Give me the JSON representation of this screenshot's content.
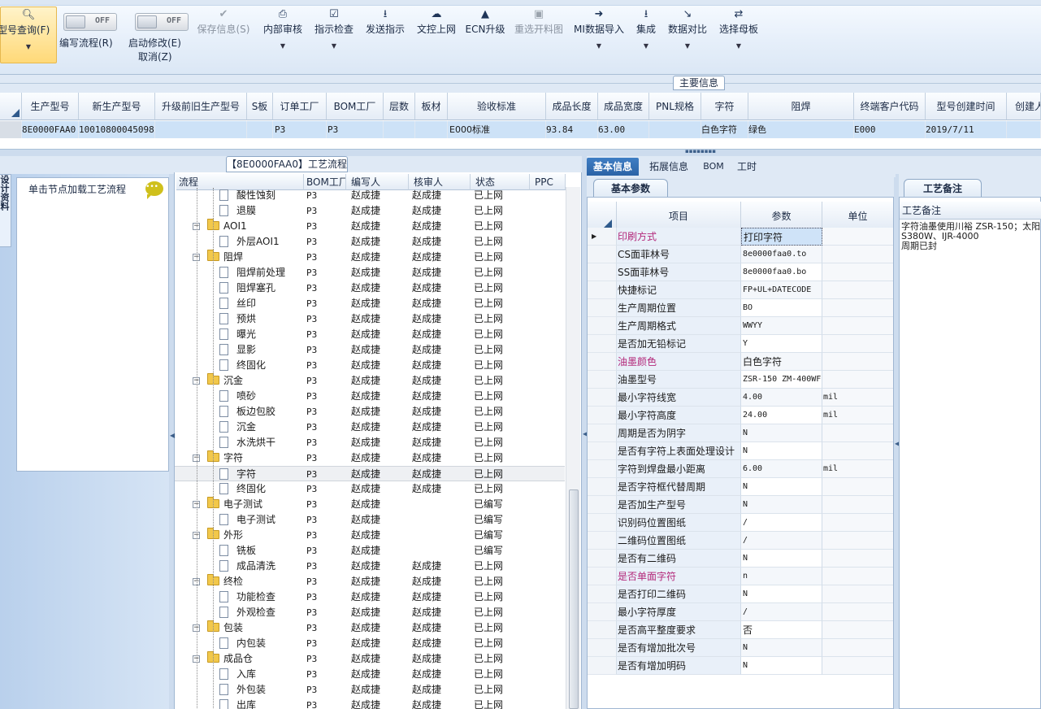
{
  "toolbar": {
    "model_query": "型号查询(F)",
    "write_flow_toggle": "OFF",
    "write_flow": "编写流程(R)",
    "start_modify_toggle": "OFF",
    "start_modify": "启动修改(E)",
    "cancel": "取消(Z)",
    "save_info": "保存信息(S)",
    "internal_review": "内部审核",
    "instruction_check": "指示检查",
    "send_instruction": "发送指示",
    "upload_doc": "文控上网",
    "ecn_upgrade": "ECN升级",
    "reselect_cut_drawing": "重选开料图",
    "mi_import": "MI数据导入",
    "integrate": "集成",
    "data_compare": "数据对比",
    "select_master": "选择母板"
  },
  "main_info_tab": "主要信息",
  "top_grid": {
    "columns": [
      "生产型号",
      "新生产型号",
      "升级前旧生产型号",
      "S板",
      "订单工厂",
      "BOM工厂",
      "层数",
      "板材",
      "验收标准",
      "成品长度",
      "成品宽度",
      "PNL规格",
      "字符",
      "阻焊",
      "终端客户代码",
      "型号创建时间",
      "创建人"
    ],
    "row": [
      "8E0000FAA0",
      "10010800045098",
      "",
      "",
      "P3",
      "P3",
      "",
      "",
      "E000标准",
      "93.84",
      "63.00",
      "",
      "白色字符",
      "绿色",
      "E000",
      "2019/7/11",
      ""
    ]
  },
  "left_panel": {
    "vtab": "设计资料",
    "message": "单击节点加载工艺流程"
  },
  "process": {
    "title": "【8E0000FAA0】工艺流程",
    "columns": [
      "流程",
      "BOM工厂",
      "编写人",
      "核审人",
      "状态",
      "PPC"
    ],
    "rows": [
      {
        "name": "酸性蚀刻",
        "level": 1,
        "bom": "P3",
        "writer": "赵成捷",
        "reviewer": "赵成捷",
        "status": "已上网"
      },
      {
        "name": "退膜",
        "level": 1,
        "bom": "P3",
        "writer": "赵成捷",
        "reviewer": "赵成捷",
        "status": "已上网"
      },
      {
        "name": "AOI1",
        "level": 0,
        "bom": "P3",
        "writer": "赵成捷",
        "reviewer": "赵成捷",
        "status": "已上网"
      },
      {
        "name": "外层AOI1",
        "level": 1,
        "bom": "P3",
        "writer": "赵成捷",
        "reviewer": "赵成捷",
        "status": "已上网"
      },
      {
        "name": "阻焊",
        "level": 0,
        "bom": "P3",
        "writer": "赵成捷",
        "reviewer": "赵成捷",
        "status": "已上网"
      },
      {
        "name": "阻焊前处理",
        "level": 1,
        "bom": "P3",
        "writer": "赵成捷",
        "reviewer": "赵成捷",
        "status": "已上网"
      },
      {
        "name": "阻焊塞孔",
        "level": 1,
        "bom": "P3",
        "writer": "赵成捷",
        "reviewer": "赵成捷",
        "status": "已上网"
      },
      {
        "name": "丝印",
        "level": 1,
        "bom": "P3",
        "writer": "赵成捷",
        "reviewer": "赵成捷",
        "status": "已上网"
      },
      {
        "name": "预烘",
        "level": 1,
        "bom": "P3",
        "writer": "赵成捷",
        "reviewer": "赵成捷",
        "status": "已上网"
      },
      {
        "name": "曝光",
        "level": 1,
        "bom": "P3",
        "writer": "赵成捷",
        "reviewer": "赵成捷",
        "status": "已上网"
      },
      {
        "name": "显影",
        "level": 1,
        "bom": "P3",
        "writer": "赵成捷",
        "reviewer": "赵成捷",
        "status": "已上网"
      },
      {
        "name": "终固化",
        "level": 1,
        "bom": "P3",
        "writer": "赵成捷",
        "reviewer": "赵成捷",
        "status": "已上网"
      },
      {
        "name": "沉金",
        "level": 0,
        "bom": "P3",
        "writer": "赵成捷",
        "reviewer": "赵成捷",
        "status": "已上网"
      },
      {
        "name": "喷砂",
        "level": 1,
        "bom": "P3",
        "writer": "赵成捷",
        "reviewer": "赵成捷",
        "status": "已上网"
      },
      {
        "name": "板边包胶",
        "level": 1,
        "bom": "P3",
        "writer": "赵成捷",
        "reviewer": "赵成捷",
        "status": "已上网"
      },
      {
        "name": "沉金",
        "level": 1,
        "bom": "P3",
        "writer": "赵成捷",
        "reviewer": "赵成捷",
        "status": "已上网"
      },
      {
        "name": "水洗烘干",
        "level": 1,
        "bom": "P3",
        "writer": "赵成捷",
        "reviewer": "赵成捷",
        "status": "已上网"
      },
      {
        "name": "字符",
        "level": 0,
        "bom": "P3",
        "writer": "赵成捷",
        "reviewer": "赵成捷",
        "status": "已上网"
      },
      {
        "name": "字符",
        "level": 1,
        "bom": "P3",
        "writer": "赵成捷",
        "reviewer": "赵成捷",
        "status": "已上网"
      },
      {
        "name": "终固化",
        "level": 1,
        "bom": "P3",
        "writer": "赵成捷",
        "reviewer": "赵成捷",
        "status": "已上网"
      },
      {
        "name": "电子测试",
        "level": 0,
        "bom": "P3",
        "writer": "赵成捷",
        "reviewer": "",
        "status": "已编写"
      },
      {
        "name": "电子测试",
        "level": 1,
        "bom": "P3",
        "writer": "赵成捷",
        "reviewer": "",
        "status": "已编写"
      },
      {
        "name": "外形",
        "level": 0,
        "bom": "P3",
        "writer": "赵成捷",
        "reviewer": "",
        "status": "已编写"
      },
      {
        "name": "铣板",
        "level": 1,
        "bom": "P3",
        "writer": "赵成捷",
        "reviewer": "",
        "status": "已编写"
      },
      {
        "name": "成品清洗",
        "level": 1,
        "bom": "P3",
        "writer": "赵成捷",
        "reviewer": "赵成捷",
        "status": "已上网"
      },
      {
        "name": "终检",
        "level": 0,
        "bom": "P3",
        "writer": "赵成捷",
        "reviewer": "赵成捷",
        "status": "已上网"
      },
      {
        "name": "功能检查",
        "level": 1,
        "bom": "P3",
        "writer": "赵成捷",
        "reviewer": "赵成捷",
        "status": "已上网"
      },
      {
        "name": "外观检查",
        "level": 1,
        "bom": "P3",
        "writer": "赵成捷",
        "reviewer": "赵成捷",
        "status": "已上网"
      },
      {
        "name": "包装",
        "level": 0,
        "bom": "P3",
        "writer": "赵成捷",
        "reviewer": "赵成捷",
        "status": "已上网"
      },
      {
        "name": "内包装",
        "level": 1,
        "bom": "P3",
        "writer": "赵成捷",
        "reviewer": "赵成捷",
        "status": "已上网"
      },
      {
        "name": "成品仓",
        "level": 0,
        "bom": "P3",
        "writer": "赵成捷",
        "reviewer": "赵成捷",
        "status": "已上网"
      },
      {
        "name": "入库",
        "level": 1,
        "bom": "P3",
        "writer": "赵成捷",
        "reviewer": "赵成捷",
        "status": "已上网"
      },
      {
        "name": "外包装",
        "level": 1,
        "bom": "P3",
        "writer": "赵成捷",
        "reviewer": "赵成捷",
        "status": "已上网"
      },
      {
        "name": "出库",
        "level": 1,
        "bom": "P3",
        "writer": "赵成捷",
        "reviewer": "赵成捷",
        "status": "已上网"
      }
    ]
  },
  "detail_tabs": [
    "基本信息",
    "拓展信息",
    "BOM",
    "工时"
  ],
  "basic_param_tab": "基本参数",
  "params": {
    "columns": [
      "项目",
      "参数",
      "单位"
    ],
    "rows": [
      {
        "name": "印刷方式",
        "value": "打印字符",
        "unit": "",
        "hl": true,
        "cjk": true
      },
      {
        "name": "CS面菲林号",
        "value": "8e0000faa0.to",
        "unit": ""
      },
      {
        "name": "SS面菲林号",
        "value": "8e0000faa0.bo",
        "unit": ""
      },
      {
        "name": "快捷标记",
        "value": "FP+UL+DATECODE",
        "unit": ""
      },
      {
        "name": "生产周期位置",
        "value": "BO",
        "unit": ""
      },
      {
        "name": "生产周期格式",
        "value": "WWYY",
        "unit": ""
      },
      {
        "name": "是否加无铅标记",
        "value": "Y",
        "unit": ""
      },
      {
        "name": "油墨颜色",
        "value": "白色字符",
        "unit": "",
        "hl": true,
        "cjk": true
      },
      {
        "name": "油墨型号",
        "value": "ZSR-150 ZM-400WF",
        "unit": ""
      },
      {
        "name": "最小字符线宽",
        "value": "4.00",
        "unit": "mil"
      },
      {
        "name": "最小字符高度",
        "value": "24.00",
        "unit": "mil"
      },
      {
        "name": "周期是否为阴字",
        "value": "N",
        "unit": ""
      },
      {
        "name": "是否有字符上表面处理设计",
        "value": "N",
        "unit": ""
      },
      {
        "name": "字符到焊盘最小距离",
        "value": "6.00",
        "unit": "mil"
      },
      {
        "name": "是否字符框代替周期",
        "value": "N",
        "unit": ""
      },
      {
        "name": "是否加生产型号",
        "value": "N",
        "unit": ""
      },
      {
        "name": "识别码位置图纸",
        "value": "/",
        "unit": ""
      },
      {
        "name": "二维码位置图纸",
        "value": "/",
        "unit": ""
      },
      {
        "name": "是否有二维码",
        "value": "N",
        "unit": ""
      },
      {
        "name": "是否单面字符",
        "value": "n",
        "unit": "",
        "hl": true
      },
      {
        "name": "是否打印二维码",
        "value": "N",
        "unit": ""
      },
      {
        "name": "最小字符厚度",
        "value": "/",
        "unit": ""
      },
      {
        "name": "是否高平整度要求",
        "value": "否",
        "unit": "",
        "cjk": true
      },
      {
        "name": "是否有增加批次号",
        "value": "N",
        "unit": ""
      },
      {
        "name": "是否有增加明码",
        "value": "N",
        "unit": ""
      }
    ]
  },
  "notes": {
    "tab": "工艺备注",
    "header": "工艺备注",
    "text": "字符油墨使用川裕 ZSR-150；太阳S380W、IJR-4000\n周期已封"
  }
}
